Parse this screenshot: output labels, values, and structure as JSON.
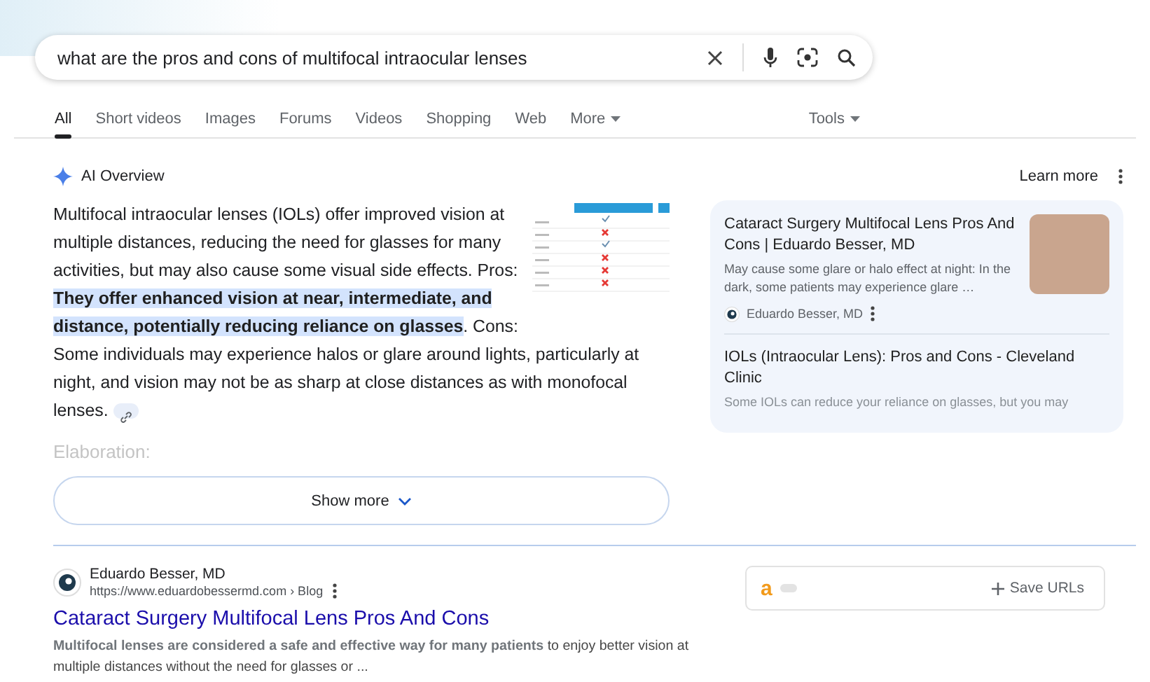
{
  "search": {
    "value": "what are the pros and cons of multifocal intraocular lenses"
  },
  "tabs": [
    {
      "label": "All",
      "selected": true
    },
    {
      "label": "Short videos",
      "selected": false
    },
    {
      "label": "Images",
      "selected": false
    },
    {
      "label": "Forums",
      "selected": false
    },
    {
      "label": "Videos",
      "selected": false
    },
    {
      "label": "Shopping",
      "selected": false
    },
    {
      "label": "Web",
      "selected": false
    }
  ],
  "more_menu": "More",
  "tools_menu": "Tools",
  "ai_overview": {
    "title": "AI Overview",
    "learn_more": "Learn more",
    "text": "Multifocal intraocular lenses (IOLs) offer improved vision at multiple distances, reducing the need for glasses for many activities, but may also cause some visual side effects. Pros: **They offer enhanced vision at near, intermediate, and distance, potentially reducing reliance on glasses**. Cons: Some individuals may experience halos or glare around lights, particularly at night, and vision may not be as sharp at close distances as with monofocal lenses.",
    "elaboration": "Elaboration:",
    "show_more": "Show more"
  },
  "sources": [
    {
      "title": "Cataract Surgery Multifocal Lens Pros And Cons | Eduardo Besser, MD",
      "snippet": "May cause some glare or halo effect at night: In the dark, some patients may experience glare …",
      "site": "Eduardo Besser, MD",
      "has_photo": true
    },
    {
      "title": "IOLs (Intraocular Lens): Pros and Cons - Cleveland Clinic",
      "snippet": "Some IOLs can reduce your reliance on glasses, but you may",
      "has_photo": false
    }
  ],
  "result": {
    "site_name": "Eduardo Besser, MD",
    "url": "https://www.eduardobessermd.com › Blog",
    "title": "Cataract Surgery Multifocal Lens Pros And Cons",
    "snippet": "**Multifocal lenses are considered a safe and effective way for many patients** to enjoy better vision at multiple distances without the need for glasses or ..."
  },
  "extension": {
    "logo": "a",
    "toggle_on": false,
    "save_button": "Save URLs"
  }
}
